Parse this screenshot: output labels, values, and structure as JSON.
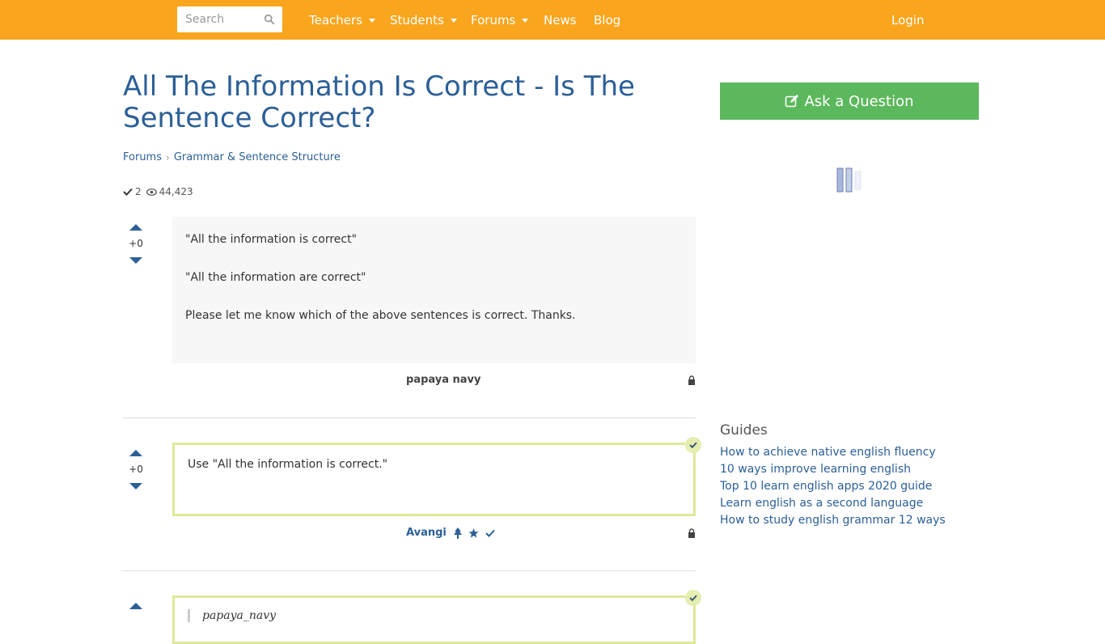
{
  "header": {
    "search_placeholder": "Search",
    "nav": [
      {
        "label": "Teachers",
        "dropdown": true
      },
      {
        "label": "Students",
        "dropdown": true
      },
      {
        "label": "Forums",
        "dropdown": true
      },
      {
        "label": "News",
        "dropdown": false
      },
      {
        "label": "Blog",
        "dropdown": false
      }
    ],
    "login": "Login"
  },
  "page": {
    "title": "All The Information Is Correct - Is The Sentence Correct?",
    "breadcrumb": [
      "Forums",
      "Grammar & Sentence Structure"
    ],
    "answers_count": "2",
    "views_count": "44,423"
  },
  "question": {
    "score": "+0",
    "body": [
      "\"All the information is correct\"",
      "\"All the information are correct\"",
      "Please let me know which of the above sentences is correct. Thanks."
    ],
    "author": "papaya navy"
  },
  "answers": [
    {
      "score": "+0",
      "body": "Use \"All the information is correct.\"",
      "author": "Avangi"
    },
    {
      "quote_author": "papaya_navy"
    }
  ],
  "sidebar": {
    "ask_button": "Ask a Question",
    "guides_title": "Guides",
    "guides": [
      "How to achieve native english fluency",
      "10 ways improve learning english",
      "Top 10 learn english apps 2020 guide",
      "Learn english as a second language",
      "How to study english grammar 12 ways"
    ]
  },
  "colors": {
    "topbar": "#f9a61e",
    "link": "#2b5f97",
    "ask_button": "#5cb85c",
    "accepted_border": "#e0e89a"
  }
}
